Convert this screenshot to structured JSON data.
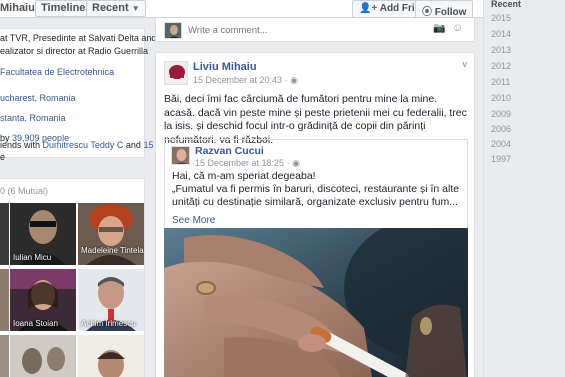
{
  "header": {
    "profile_name": "Mihaiu",
    "timeline_label": "Timeline",
    "recent_label": "Recent",
    "add_friend_label": "Add Friend",
    "follow_label": "Follow"
  },
  "intro": {
    "line1": "at TVR, Presedinte at Salvati Delta and",
    "line2": "ealizator si director at Radio Guerrilla",
    "line3": "Facultatea de Electrotehnica",
    "line4": "ucharest, Romania",
    "line5": "stanta, Romania",
    "line6_prefix": "by ",
    "line6_count": "39,909 people",
    "line7_prefix": "iends with ",
    "line7_names": "Dumitrescu Teddy C",
    "line7_mid": " and ",
    "line7_more": "15",
    "line8": "e"
  },
  "friends": {
    "header": "0 (6 Mutual)",
    "items": [
      {
        "name": "Iulian Micu"
      },
      {
        "name": "Madeleine Tintela"
      },
      {
        "name": "Ioana Stoian"
      },
      {
        "name": "Achim Irimescu"
      }
    ]
  },
  "comment_box": {
    "placeholder": "Write a comment..."
  },
  "post": {
    "author": "Liviu Mihaiu",
    "timestamp": "15 December at 20:43",
    "text": "Băi, deci îmi fac cârciumă de fumători pentru mine la mine. acasă. dacă vin peste mine și peste prietenii mei cu federalii, trec la isis. și deschid focul intr-o grădiniță de copii din părinți nefumători. va fi război.",
    "shared": {
      "author": "Razvan Cucui",
      "timestamp": "15 December at 18:25",
      "text_line1": "Hai, că m-am speriat degeaba!",
      "text_line2": "„Fumatul va fi permis în baruri, discoteci, restaurante și în alte unități cu destinație similară, organizate exclusiv pentru fum...",
      "see_more": "See More"
    }
  },
  "year_nav": {
    "items": [
      "Recent",
      "2015",
      "2014",
      "2013",
      "2012",
      "2011",
      "2010",
      "2009",
      "2006",
      "2004",
      "1997"
    ]
  },
  "colors": {
    "link": "#365899",
    "background": "#e9ebee",
    "card": "#ffffff"
  }
}
